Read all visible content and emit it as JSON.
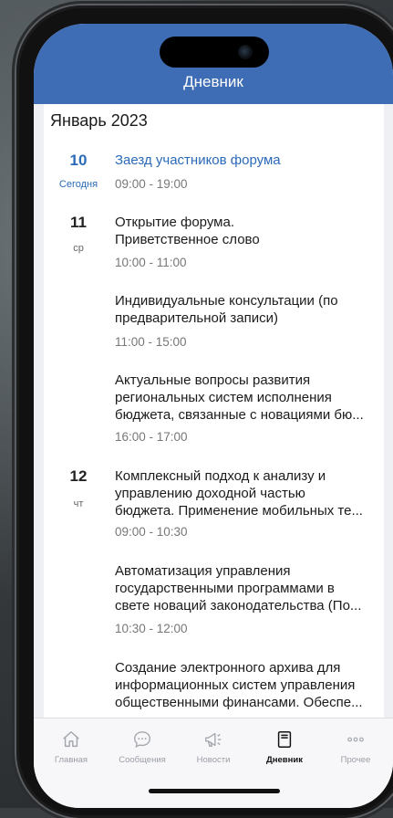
{
  "header": {
    "title": "Дневник"
  },
  "month": "Январь 2023",
  "days": [
    {
      "num": "10",
      "sub": "Сегодня",
      "today": true
    },
    {
      "num": "11",
      "sub": "ср",
      "today": false
    },
    {
      "num": "12",
      "sub": "чт",
      "today": false
    }
  ],
  "events": [
    {
      "title": "Заезд участников форума",
      "time": "09:00 - 19:00"
    },
    {
      "title_lines": [
        "Открытие форума.",
        "Приветственное слово"
      ],
      "time": "10:00 - 11:00"
    },
    {
      "title_lines": [
        "Индивидуальные консультации (по",
        "предварительной записи)"
      ],
      "time": "11:00 - 15:00"
    },
    {
      "title_lines": [
        "Актуальные вопросы развития",
        "региональных систем исполнения",
        "бюджета, связанные с новациями бю..."
      ],
      "time": "16:00 - 17:00"
    },
    {
      "title_lines": [
        "Комплексный подход к анализу и",
        "управлению доходной частью",
        "бюджета. Применение мобильных те..."
      ],
      "time": "09:00 - 10:30"
    },
    {
      "title_lines": [
        "Автоматизация управления",
        "государственными программами в",
        "свете новаций законодательства (По..."
      ],
      "time": "10:30 - 12:00"
    },
    {
      "title_lines": [
        "Создание электронного архива для",
        "информационных систем управления",
        "общественными финансами. Обеспе..."
      ]
    }
  ],
  "tabs": [
    {
      "label": "Главная",
      "icon": "home-icon"
    },
    {
      "label": "Сообщения",
      "icon": "chat-icon"
    },
    {
      "label": "Новости",
      "icon": "megaphone-icon"
    },
    {
      "label": "Дневник",
      "icon": "notebook-icon",
      "active": true
    },
    {
      "label": "Прочее",
      "icon": "more-icon"
    }
  ],
  "colors": {
    "header": "#3f6db5",
    "accent": "#2a6ab7"
  }
}
